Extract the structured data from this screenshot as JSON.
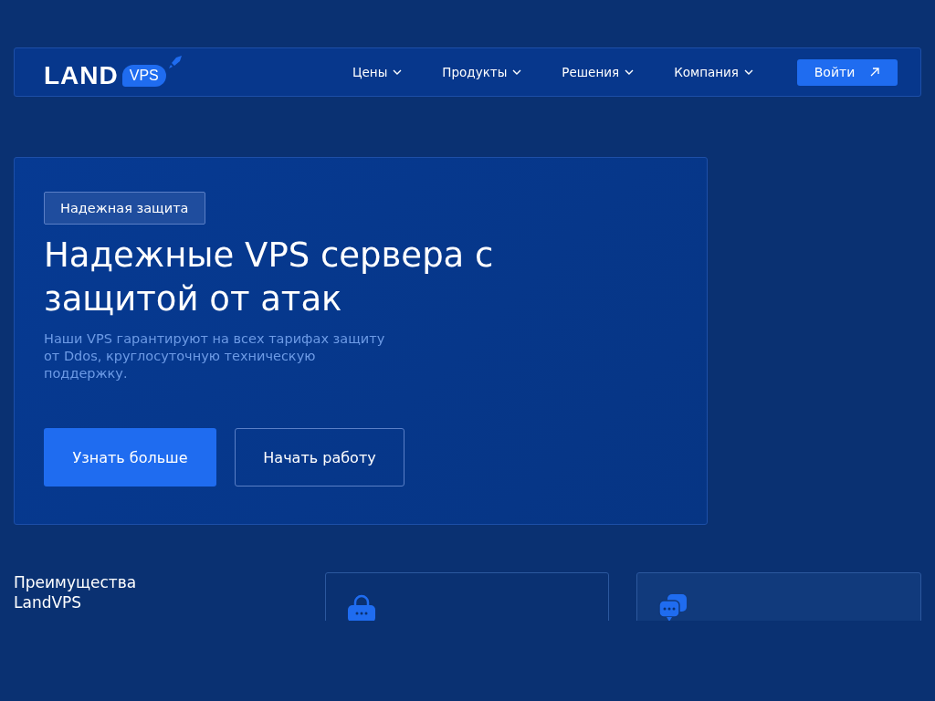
{
  "logo": {
    "word": "LAND",
    "badge": "VPS"
  },
  "nav": {
    "items": [
      {
        "label": "Цены"
      },
      {
        "label": "Продукты"
      },
      {
        "label": "Решения"
      },
      {
        "label": "Компания"
      }
    ],
    "login": "Войти"
  },
  "hero": {
    "tag": "Надежная защита",
    "title": "Надежные VPS сервера с защитой от атак",
    "text": "Наши VPS гарантируют на всех тарифах защиту от Ddos, круглосуточную техническую поддержку.",
    "primary": "Узнать больше",
    "secondary": "Начать работу"
  },
  "advantages": {
    "title": "Преимущества LandVPS",
    "cards": [
      {
        "kind": "lock"
      },
      {
        "kind": "chat"
      }
    ]
  }
}
